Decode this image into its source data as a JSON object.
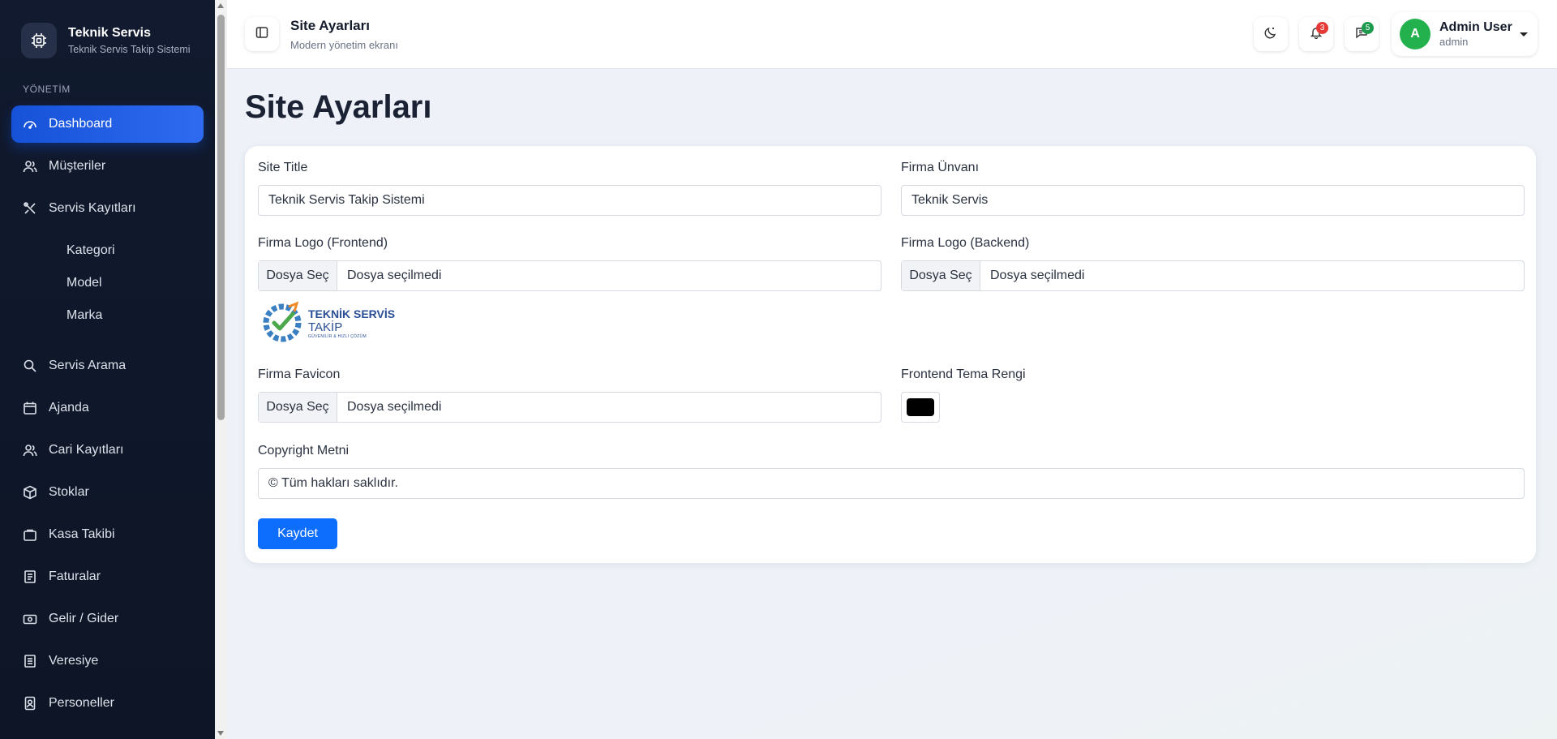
{
  "brand": {
    "title": "Teknik Servis",
    "subtitle": "Teknik Servis Takip Sistemi"
  },
  "sidebar": {
    "section_label": "YÖNETİM",
    "items": [
      {
        "label": "Dashboard",
        "icon": "gauge-icon",
        "active": true
      },
      {
        "label": "Müşteriler",
        "icon": "users-icon"
      },
      {
        "label": "Servis Kayıtları",
        "icon": "tools-icon"
      },
      {
        "label": "Servis Arama",
        "icon": "search-icon"
      },
      {
        "label": "Ajanda",
        "icon": "calendar-icon"
      },
      {
        "label": "Cari Kayıtları",
        "icon": "people-icon"
      },
      {
        "label": "Stoklar",
        "icon": "box-icon"
      },
      {
        "label": "Kasa Takibi",
        "icon": "briefcase-icon"
      },
      {
        "label": "Faturalar",
        "icon": "invoice-icon"
      },
      {
        "label": "Gelir / Gider",
        "icon": "cash-icon"
      },
      {
        "label": "Veresiye",
        "icon": "ledger-icon"
      },
      {
        "label": "Personeller",
        "icon": "badge-icon"
      }
    ],
    "sub_items": [
      "Kategori",
      "Model",
      "Marka"
    ]
  },
  "topbar": {
    "title": "Site Ayarları",
    "subtitle": "Modern yönetim ekranı",
    "notifications_count": "3",
    "messages_count": "5",
    "user": {
      "initial": "A",
      "name": "Admin User",
      "role": "admin"
    }
  },
  "page": {
    "heading": "Site Ayarları"
  },
  "form": {
    "site_title": {
      "label": "Site Title",
      "value": "Teknik Servis Takip Sistemi"
    },
    "company_name": {
      "label": "Firma Ünvanı",
      "value": "Teknik Servis"
    },
    "logo_frontend": {
      "label": "Firma Logo (Frontend)",
      "button": "Dosya Seç",
      "status": "Dosya seçilmedi"
    },
    "logo_backend": {
      "label": "Firma Logo (Backend)",
      "button": "Dosya Seç",
      "status": "Dosya seçilmedi"
    },
    "logo_preview": {
      "line1": "TEKNİK SERVİS",
      "line2": "TAKİP",
      "line3": "GÜVENİLİR & HIZLI ÇÖZÜM"
    },
    "favicon": {
      "label": "Firma Favicon",
      "button": "Dosya Seç",
      "status": "Dosya seçilmedi"
    },
    "theme_color": {
      "label": "Frontend Tema Rengi",
      "value": "#000000"
    },
    "copyright": {
      "label": "Copyright Metni",
      "value": "© Tüm hakları saklıdır."
    },
    "save_label": "Kaydet"
  }
}
